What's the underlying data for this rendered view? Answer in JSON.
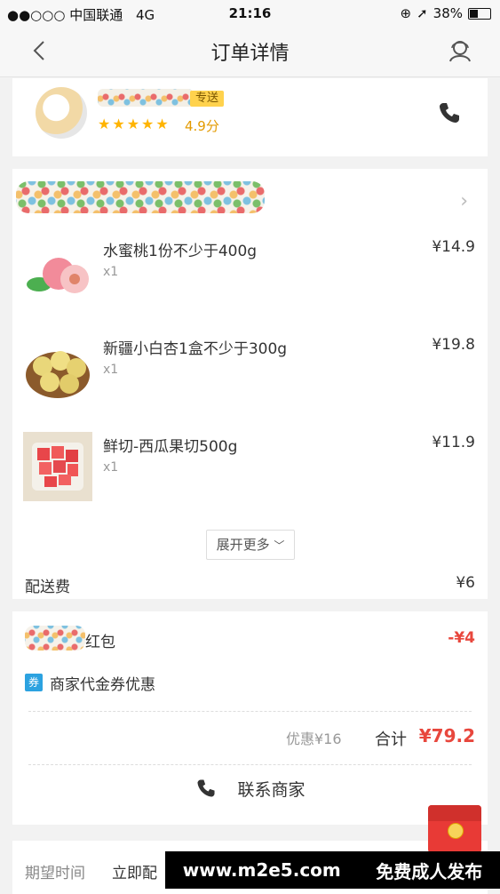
{
  "status_bar": {
    "carrier": "●●○○○ 中国联通",
    "network": "4G",
    "time": "21:16",
    "battery_percent": "38%"
  },
  "nav": {
    "title": "订单详情"
  },
  "rider": {
    "badge": "专送",
    "stars": "★★★★★",
    "rating": "4.9分"
  },
  "items": [
    {
      "name": "水蜜桃1份不少于400g",
      "qty": "x1",
      "price": "¥14.9"
    },
    {
      "name": "新疆小白杏1盒不少于300g",
      "qty": "x1",
      "price": "¥19.8"
    },
    {
      "name": "鲜切-西瓜果切500g",
      "qty": "x1",
      "price": "¥11.9"
    }
  ],
  "expand_label": "展开更多",
  "delivery_fee": {
    "label": "配送费",
    "value": "¥6"
  },
  "hongbao": {
    "label": "红包",
    "value": "-¥4"
  },
  "coupon": {
    "icon": "券",
    "label": "商家代金券优惠"
  },
  "summary": {
    "discount": "优惠¥16",
    "total_label": "合计",
    "total_value": "¥79.2"
  },
  "contact_label": "联系商家",
  "expect": {
    "label": "期望时间",
    "value": "立即配"
  },
  "watermark": {
    "url": "www.m2e5.com",
    "text": "免费成人发布"
  }
}
